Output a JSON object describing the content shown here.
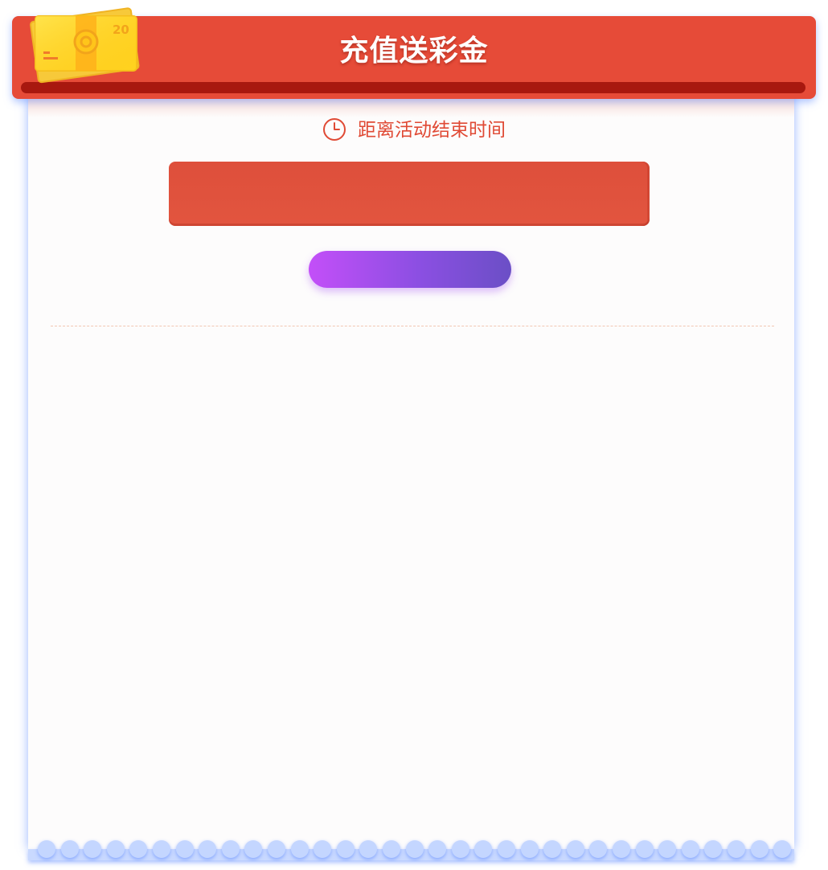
{
  "header": {
    "title": "充值送彩金"
  },
  "logo": {
    "icon": "money-bills-icon",
    "denomination": "20"
  },
  "countdown": {
    "label": "距离活动结束时间",
    "icon": "clock-icon"
  },
  "colors": {
    "header_red": "#e64b38",
    "slot_dark_red": "#a8180f",
    "countdown_box_red": "#e2553f",
    "button_gradient_start": "#c34ff8",
    "button_gradient_end": "#6b4fc6",
    "paper_bg": "#fdfcfc",
    "frame_glow_blue": "#c4d6ff",
    "accent_text_red": "#e04a35"
  }
}
